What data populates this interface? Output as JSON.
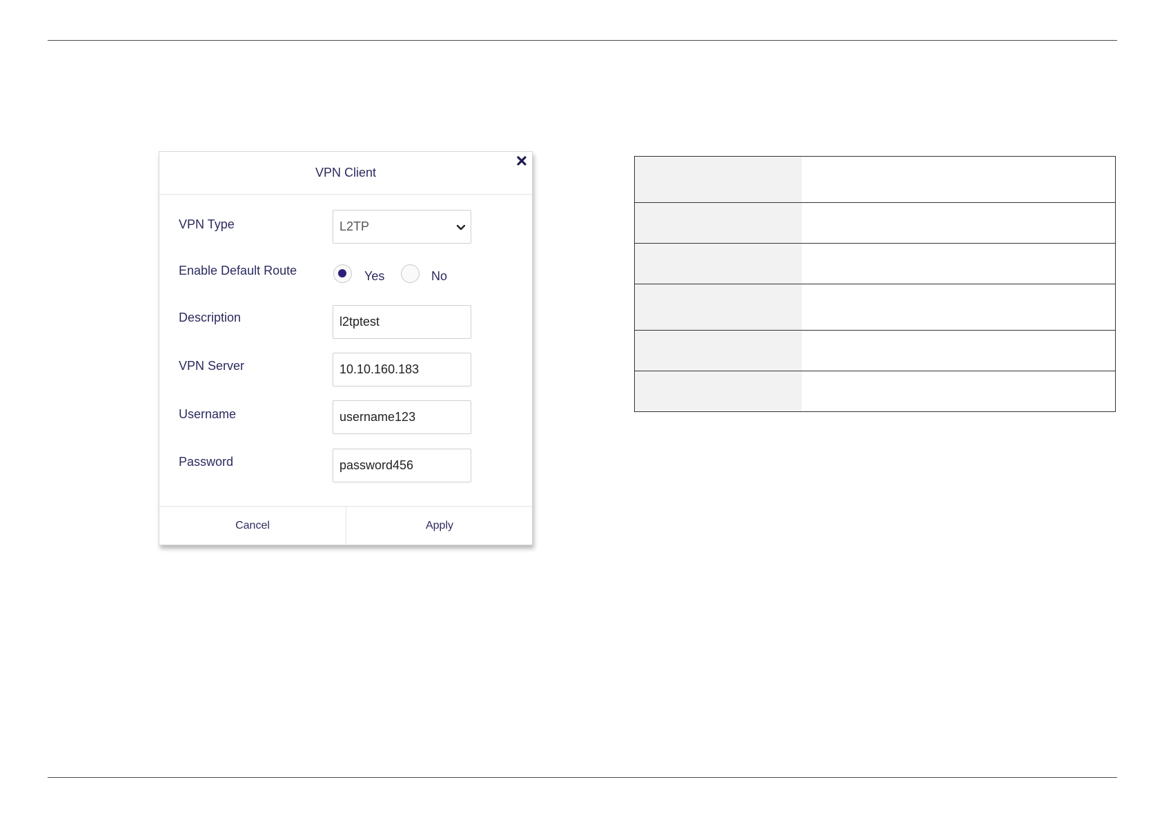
{
  "dialog": {
    "title": "VPN Client",
    "close_icon": "close-icon",
    "fields": {
      "vpn_type": {
        "label": "VPN Type",
        "value": "L2TP"
      },
      "default_route": {
        "label": "Enable Default Route",
        "options": [
          {
            "label": "Yes",
            "checked": true
          },
          {
            "label": "No",
            "checked": false
          }
        ]
      },
      "description": {
        "label": "Description",
        "value": "l2tptest"
      },
      "vpn_server": {
        "label": "VPN Server",
        "value": "10.10.160.183"
      },
      "username": {
        "label": "Username",
        "value": "username123"
      },
      "password": {
        "label": "Password",
        "value": "password456"
      }
    },
    "footer": {
      "cancel_label": "Cancel",
      "apply_label": "Apply"
    }
  },
  "colors": {
    "text": "#2b2a5e",
    "radio_checked": "#2b1f7a",
    "table_key_bg": "#f2f2f2",
    "rule": "#4a4a4a"
  },
  "table": {
    "rows": [
      {
        "key": "",
        "value": ""
      },
      {
        "key": "",
        "value": ""
      },
      {
        "key": "",
        "value": ""
      },
      {
        "key": "",
        "value": ""
      },
      {
        "key": "",
        "value": ""
      },
      {
        "key": "",
        "value": ""
      }
    ]
  }
}
